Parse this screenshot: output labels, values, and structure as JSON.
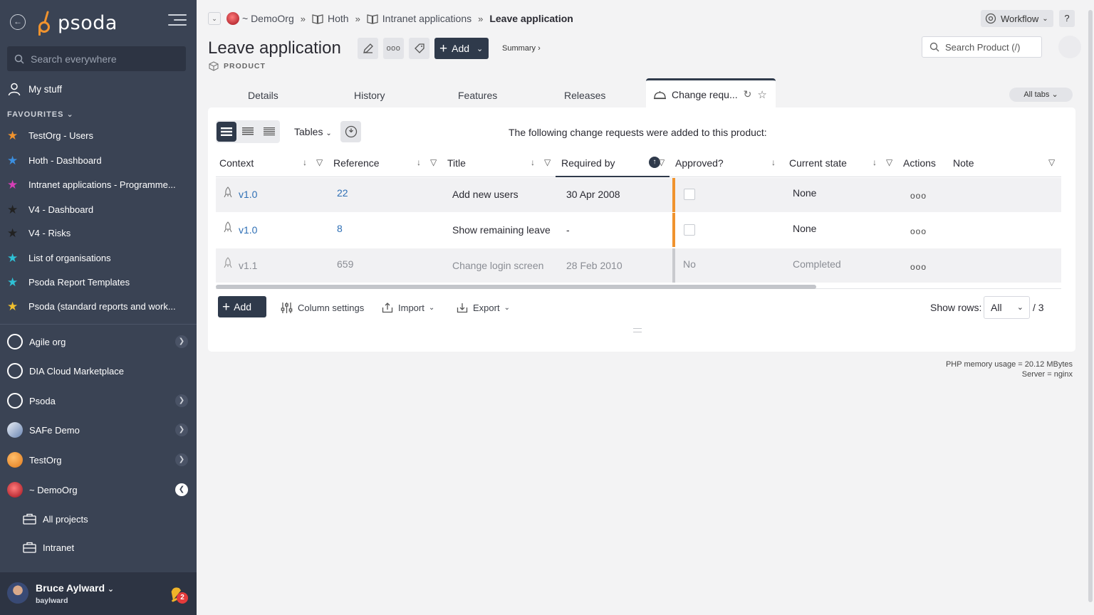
{
  "sidebar": {
    "logo_text": "psoda",
    "search_placeholder": "Search everywhere",
    "my_stuff": "My stuff",
    "favourites_heading": "FAVOURITES",
    "favourites": [
      {
        "label": "TestOrg - Users",
        "star_color": "#f0932e"
      },
      {
        "label": "Hoth - Dashboard",
        "star_color": "#3b8fe0"
      },
      {
        "label": "Intranet applications - Programme...",
        "star_color": "#d63fb7"
      },
      {
        "label": "V4 - Dashboard",
        "star_color": "#2b2b33"
      },
      {
        "label": "V4 - Risks",
        "star_color": "#2b2b33"
      },
      {
        "label": "List of organisations",
        "star_color": "#2ec1d6"
      },
      {
        "label": "Psoda Report Templates",
        "star_color": "#2ec1d6"
      },
      {
        "label": "Psoda (standard reports and work...",
        "star_color": "#f0c02e"
      }
    ],
    "orgs": [
      {
        "label": "Agile org",
        "expandable": true
      },
      {
        "label": "DIA Cloud Marketplace",
        "expandable": false
      },
      {
        "label": "Psoda",
        "expandable": true
      },
      {
        "label": "SAFe Demo",
        "expandable": true
      },
      {
        "label": "TestOrg",
        "expandable": true
      },
      {
        "label": "~ DemoOrg",
        "expandable": true,
        "open": true
      }
    ],
    "sub_items": [
      "All projects",
      "Intranet"
    ],
    "user": {
      "name": "Bruce Aylward",
      "handle": "baylward",
      "notifications": "2"
    }
  },
  "breadcrumb": {
    "items": [
      "~ DemoOrg",
      "Hoth",
      "Intranet applications"
    ],
    "current": "Leave application",
    "separator": "»"
  },
  "header": {
    "title": "Leave application",
    "type": "PRODUCT",
    "add_label": "Add",
    "summary_link": "Summary ›",
    "search_placeholder": "Search Product (/)",
    "workflow_label": "Workflow",
    "help_label": "?"
  },
  "tabs": {
    "items": [
      "Details",
      "History",
      "Features",
      "Releases"
    ],
    "active": "Change requ...",
    "all_tabs": "All tabs"
  },
  "toolbar": {
    "tables_label": "Tables",
    "intro_text": "The following change requests were added to this product:"
  },
  "table": {
    "columns": [
      "Context",
      "Reference",
      "Title",
      "Required by",
      "Approved?",
      "Current state",
      "Actions",
      "Note"
    ],
    "rows": [
      {
        "context": "v1.0",
        "reference": "22",
        "title": "Add new users",
        "required_by": "30 Apr 2008",
        "approved": "",
        "state": "None",
        "actions": "ooo"
      },
      {
        "context": "v1.0",
        "reference": "8",
        "title": "Show remaining leave",
        "required_by": "-",
        "approved": "",
        "state": "None",
        "actions": "ooo"
      },
      {
        "context": "v1.1",
        "reference": "659",
        "title": "Change login screen",
        "required_by": "28 Feb 2010",
        "approved": "No",
        "state": "Completed",
        "actions": "ooo"
      }
    ]
  },
  "footer_bar": {
    "add_label": "Add",
    "column_settings": "Column settings",
    "import_label": "Import",
    "export_label": "Export",
    "show_rows_label": "Show rows:",
    "show_rows_value": "All",
    "rows_total": "/ 3"
  },
  "server_info": {
    "memory": "PHP memory usage = 20.12 MBytes",
    "server": "Server = nginx"
  },
  "colors": {
    "sidebar_bg": "#3a4354",
    "primary": "#2f3a4b",
    "link": "#2e6fb5",
    "warning_bar": "#f0932e"
  }
}
